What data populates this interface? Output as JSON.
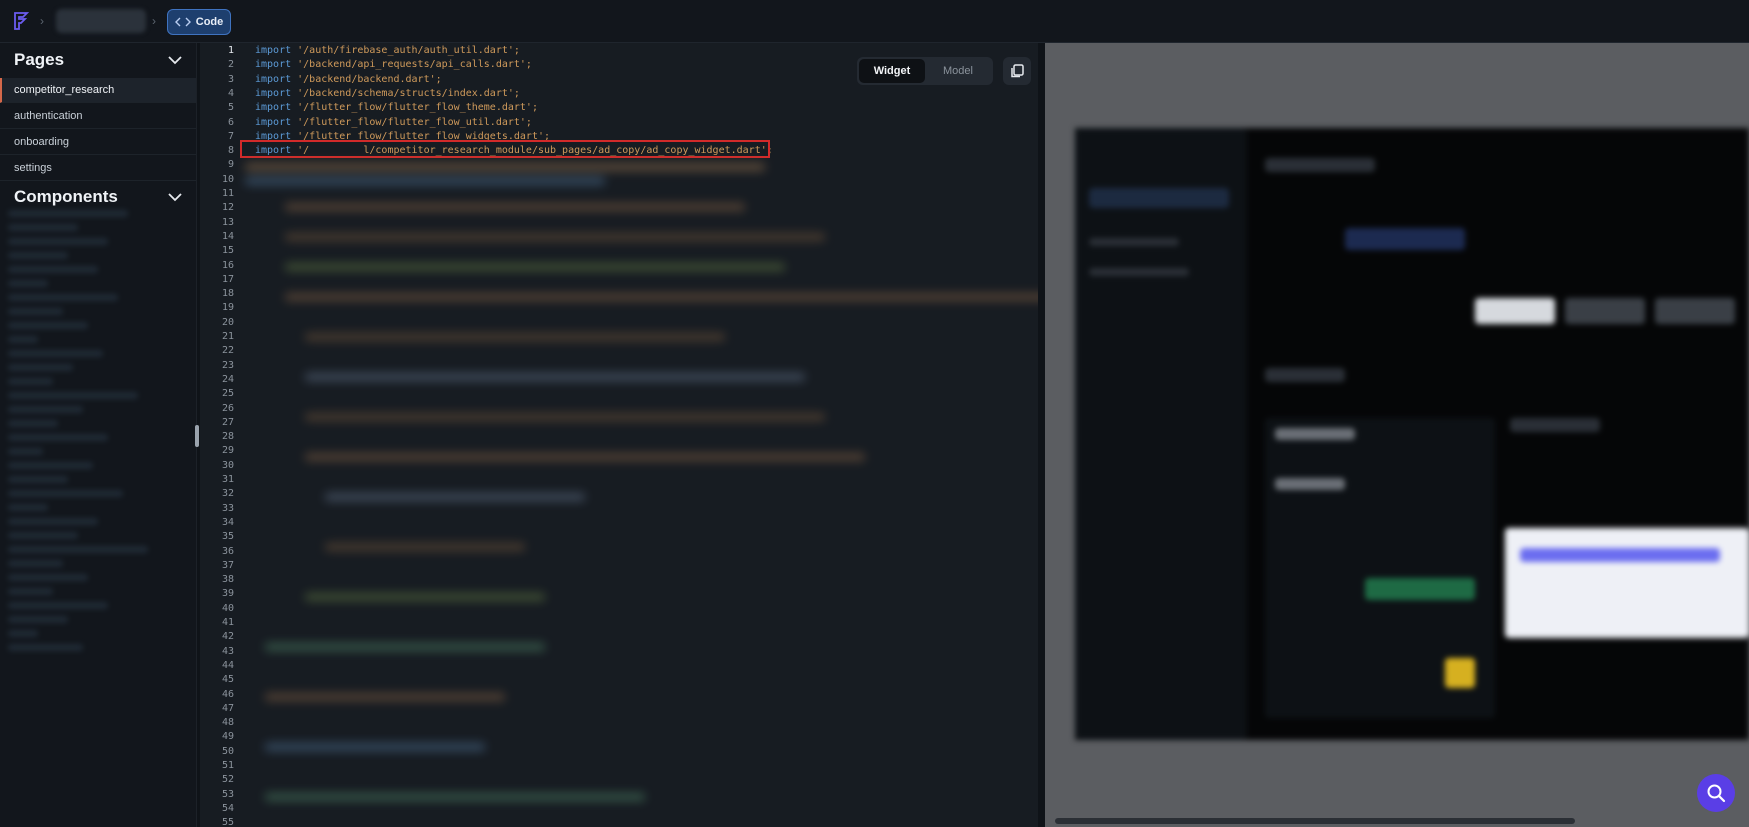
{
  "topbar": {
    "code_button_label": "Code",
    "accent": "#1e3f6e"
  },
  "sidebar": {
    "pages_heading": "Pages",
    "pages": [
      {
        "label": "competitor_research",
        "active": true
      },
      {
        "label": "authentication",
        "active": false
      },
      {
        "label": "onboarding",
        "active": false
      },
      {
        "label": "settings",
        "active": false
      }
    ],
    "components_heading": "Components"
  },
  "editor": {
    "view_toggle": {
      "active": "Widget",
      "inactive": "Model"
    },
    "highlight_color": "#d22a2a",
    "lines": [
      {
        "kw": "import",
        "str": " '/auth/firebase_auth/auth_util.dart';"
      },
      {
        "kw": "import",
        "str": " '/backend/api_requests/api_calls.dart';"
      },
      {
        "kw": "import",
        "str": " '/backend/backend.dart';"
      },
      {
        "kw": "import",
        "str": " '/backend/schema/structs/index.dart';"
      },
      {
        "kw": "import",
        "str": " '/flutter_flow/flutter_flow_theme.dart';"
      },
      {
        "kw": "import",
        "str": " '/flutter_flow/flutter_flow_util.dart';"
      },
      {
        "kw": "import",
        "str": " '/flutter_flow/flutter_flow_widgets.dart';"
      },
      {
        "kw": "import",
        "str": " '/         l/competitor_research_module/sub_pages/ad_copy/ad_copy_widget.dart';"
      }
    ],
    "line_numbers": [
      "1",
      "2",
      "3",
      "4",
      "5",
      "6",
      "7",
      "8",
      "9",
      "10",
      "11",
      "12",
      "13",
      "14",
      "15",
      "16",
      "17",
      "18",
      "19",
      "20",
      "21",
      "22",
      "23",
      "24",
      "25",
      "26",
      "27",
      "28",
      "29",
      "30",
      "31",
      "32",
      "33",
      "34",
      "35",
      "36",
      "37",
      "38",
      "39",
      "40",
      "41",
      "42",
      "43",
      "44",
      "45",
      "46",
      "47",
      "48",
      "49",
      "50",
      "51",
      "52",
      "53",
      "54",
      "55"
    ]
  }
}
